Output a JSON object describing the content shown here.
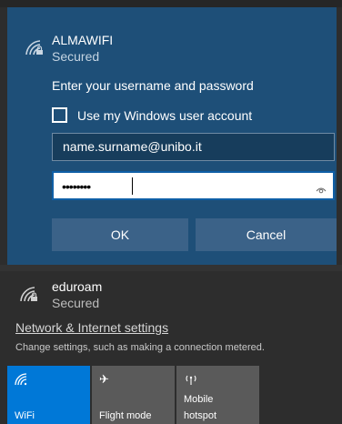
{
  "selected_network": {
    "icon": "wifi-secured-icon",
    "ssid": "ALMAWIFI",
    "status": "Secured",
    "prompt": "Enter your username and password",
    "use_windows_account_label": "Use my Windows user account",
    "use_windows_account_checked": false,
    "username_value": "name.surname@unibo.it",
    "password_mask": "••••••••",
    "ok_label": "OK",
    "cancel_label": "Cancel"
  },
  "other_networks": [
    {
      "icon": "wifi-secured-icon",
      "ssid": "eduroam",
      "status": "Secured"
    }
  ],
  "settings": {
    "link_label": "Network & Internet settings",
    "description": "Change settings, such as making a connection metered."
  },
  "quick_actions": [
    {
      "icon": "wifi-icon",
      "label": "WiFi",
      "active": true
    },
    {
      "icon": "airplane-icon",
      "label": "Flight mode",
      "active": false
    },
    {
      "icon": "mobile-hotspot-icon",
      "label_line1": "Mobile",
      "label_line2": "hotspot",
      "active": false
    }
  ],
  "colors": {
    "panel_background": "#2d2d2d",
    "selected_background": "#1e4f78",
    "button_background": "#3b6288",
    "accent": "#0078d7",
    "tile_inactive": "#5a5a5a"
  }
}
